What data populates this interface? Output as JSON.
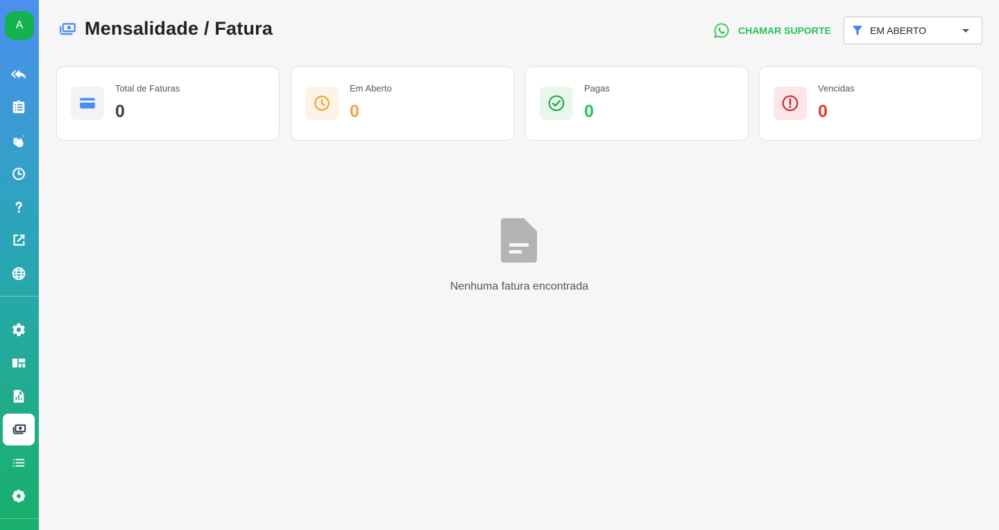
{
  "sidebar": {
    "avatar_letter": "A",
    "items": [
      {
        "icon": "reply-all-icon"
      },
      {
        "icon": "clipboard-icon"
      },
      {
        "icon": "hand-icon"
      },
      {
        "icon": "clock-icon"
      },
      {
        "icon": "help-icon"
      },
      {
        "icon": "external-link-icon"
      },
      {
        "icon": "globe-icon"
      },
      {
        "icon": "gear-icon"
      },
      {
        "icon": "dashboard-icon"
      },
      {
        "icon": "report-icon"
      },
      {
        "icon": "money-icon",
        "active": true
      },
      {
        "icon": "list-icon"
      },
      {
        "icon": "flower-gear-icon"
      }
    ]
  },
  "header": {
    "title": "Mensalidade / Fatura",
    "support_label": "CHAMAR SUPORTE",
    "filter_value": "EM ABERTO"
  },
  "cards": [
    {
      "label": "Total de Faturas",
      "value": "0",
      "color": "#3a3f4b",
      "icon": "credit-card-icon",
      "icon_bg": "#f2f3f5",
      "icon_color": "#4d8ff0"
    },
    {
      "label": "Em Aberto",
      "value": "0",
      "color": "#f5a040",
      "icon": "clock-icon",
      "icon_bg": "#fdf3e6",
      "icon_color": "#f0a030"
    },
    {
      "label": "Pagas",
      "value": "0",
      "color": "#22c55e",
      "icon": "check-circle-icon",
      "icon_bg": "#e8f7ec",
      "icon_color": "#22a84a"
    },
    {
      "label": "Vencidas",
      "value": "0",
      "color": "#e53935",
      "icon": "alert-circle-icon",
      "icon_bg": "#fbe6e8",
      "icon_color": "#c62828"
    }
  ],
  "empty_state": {
    "message": "Nenhuma fatura encontrada",
    "icon": "document-icon"
  },
  "colors": {
    "accent_green": "#25c15a",
    "accent_blue": "#4d8ff0"
  }
}
